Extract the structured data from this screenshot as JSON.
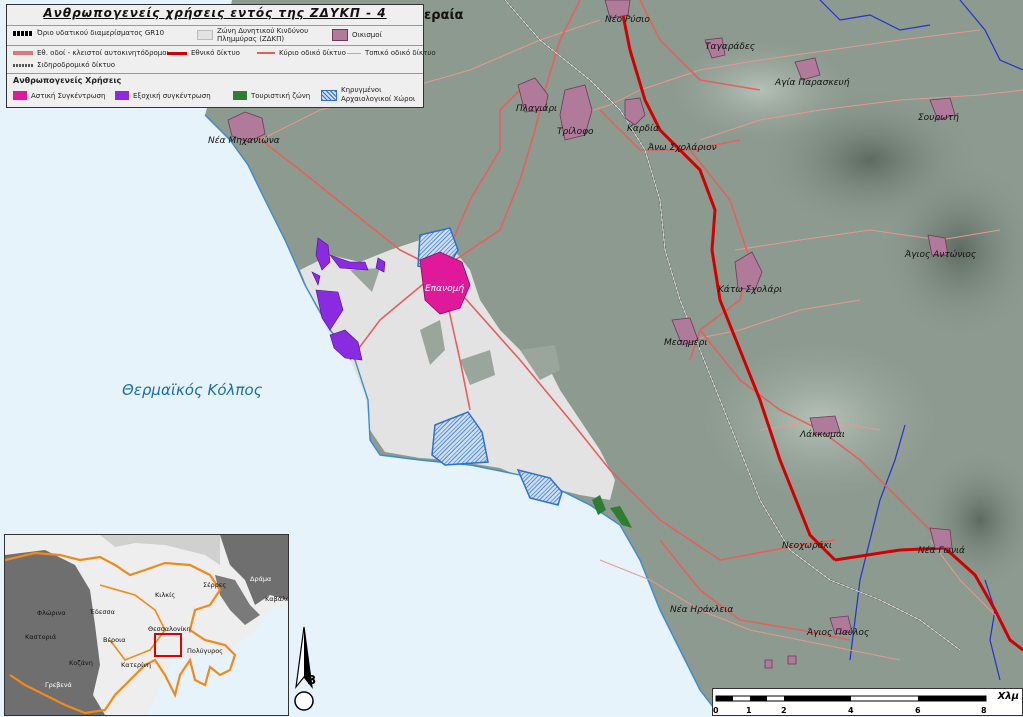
{
  "legend": {
    "title": "Ανθρωπογενείς χρήσεις εντός της ΖΔΥΚΠ - 4",
    "items": {
      "boundary": "Όριο υδατικού διαμερίσματος GR10",
      "flood_zone": "Ζώνη Δυνητικού Κινδύνου Πλημμύρας (ΖΔΚΠ)",
      "settlements": "Οικισμοί",
      "motorways": "Εθ. οδοί - κλειστοί αυτοκινητόδρομοι",
      "national_road": "Εθνικό δίκτυο",
      "main_road": "Κύριο οδικό δίκτυο",
      "local_road": "Τοπικό οδικό δίκτυο",
      "railway": "Σιδηροδρομικό δίκτυο"
    },
    "uses_heading": "Ανθρωπογενείς Χρήσεις",
    "uses": {
      "urban": "Αστική Συγκέντρωση",
      "holiday": "Εξοχική συγκέντρωση",
      "tourist": "Τουριστική ζώνη",
      "archaeo": "Κηρυγμένοι Αρχαιολογικοί Χώροι"
    },
    "colors": {
      "urban": "#e0199a",
      "holiday": "#8a2be2",
      "tourist": "#2e7d32",
      "archaeo": "#2f6fd0",
      "national": "#d40000",
      "main": "#e8736f",
      "flood": "#e2e2e2"
    }
  },
  "places": {
    "peraia": "εραία",
    "neo_rysio": "Νέο Ρύσιο",
    "tagarades": "Ταγαράδες",
    "agia_paraskevi": "Αγία Παρασκευή",
    "plagiari": "Πλαγιάρι",
    "trilofo": "Τρίλοφο",
    "kardia": "Καρδία",
    "ano_scholari": "Άνω Σχολάριον",
    "sourotі": "Σουρωτή",
    "nea_michaniona": "Νέα Μηχανιώνα",
    "agios_antonios": "Άγιος Αντώνιος",
    "epanomi": "Επανομή",
    "kato_scholari": "Κάτω Σχολάρι",
    "mesimeri": "Μεσημέρι",
    "lakkomai": "Λάκκωμαι",
    "neochoraki": "Νεοχωράκι",
    "nea_gonia": "Νέα Γωνιά",
    "nea_irakleia": "Νέα Ηράκλεια",
    "agios_pavlos": "Άγιος Παύλος"
  },
  "sea_label": "Θερμαϊκός Κόλπος",
  "inset": {
    "florina": "Φλώρινα",
    "edessa": "Έδεσσα",
    "kilkis": "Κιλκίς",
    "serres": "Σέρρες",
    "drama": "Δράμα",
    "kavala": "Καβάλα",
    "kastoria": "Καστοριά",
    "veroia": "Βέροια",
    "thessaloniki": "Θεσσαλονίκη",
    "kozani": "Κοζάνη",
    "katerini": "Κατερίνη",
    "polygyros": "Πολύγυρος",
    "grevena": "Γρεβενά"
  },
  "north_label": "Β",
  "scale": {
    "unit": "Χλμ",
    "ticks": [
      "0",
      "1",
      "2",
      "4",
      "6",
      "8"
    ]
  }
}
